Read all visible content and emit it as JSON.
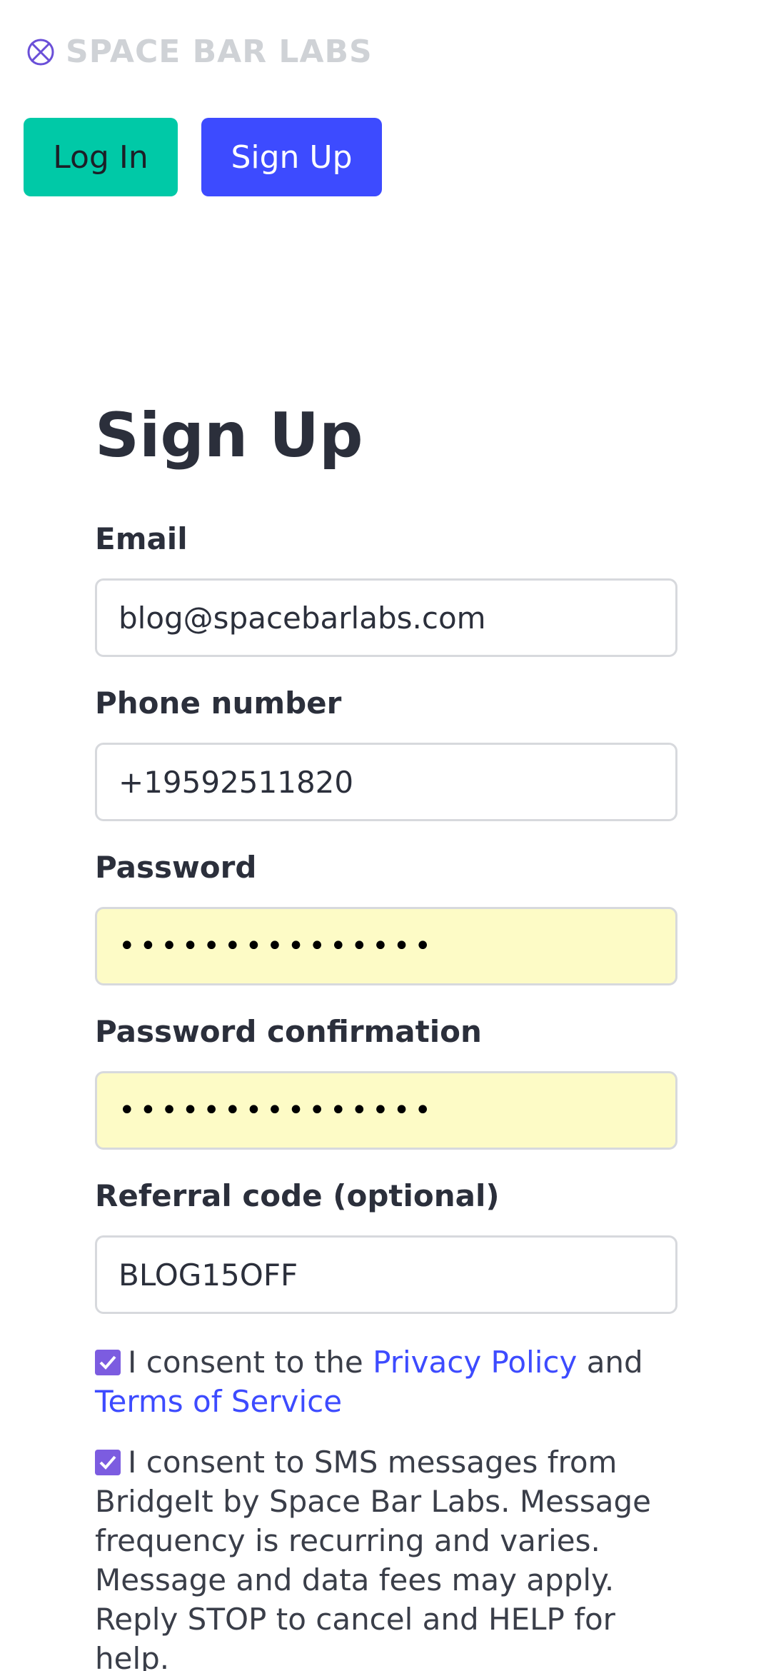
{
  "brand": {
    "name": "SPACE BAR LABS",
    "icon": "planet-logo-icon",
    "accent": "#6a4fd8"
  },
  "auth": {
    "login_label": "Log In",
    "signup_label": "Sign Up",
    "login_color": "#00c9a7",
    "signup_color": "#3d4bff"
  },
  "form": {
    "title": "Sign Up",
    "email": {
      "label": "Email",
      "value": "blog@spacebarlabs.com"
    },
    "phone": {
      "label": "Phone number",
      "value": "+19592511820"
    },
    "password": {
      "label": "Password",
      "value": "•••••••••••••••"
    },
    "password_confirmation": {
      "label": "Password confirmation",
      "value": "•••••••••••••••"
    },
    "referral": {
      "label": "Referral code (optional)",
      "value": "BLOG15OFF"
    }
  },
  "consent": {
    "terms": {
      "checked": true,
      "prefix": "I consent to the ",
      "privacy_link": "Privacy Policy",
      "middle": " and ",
      "terms_link": "Terms of Service"
    },
    "sms": {
      "checked": true,
      "text": "I consent to SMS messages from BridgeIt by Space Bar Labs. Message frequency is recurring and varies. Message and data fees may apply. Reply STOP to cancel and HELP for help."
    }
  }
}
